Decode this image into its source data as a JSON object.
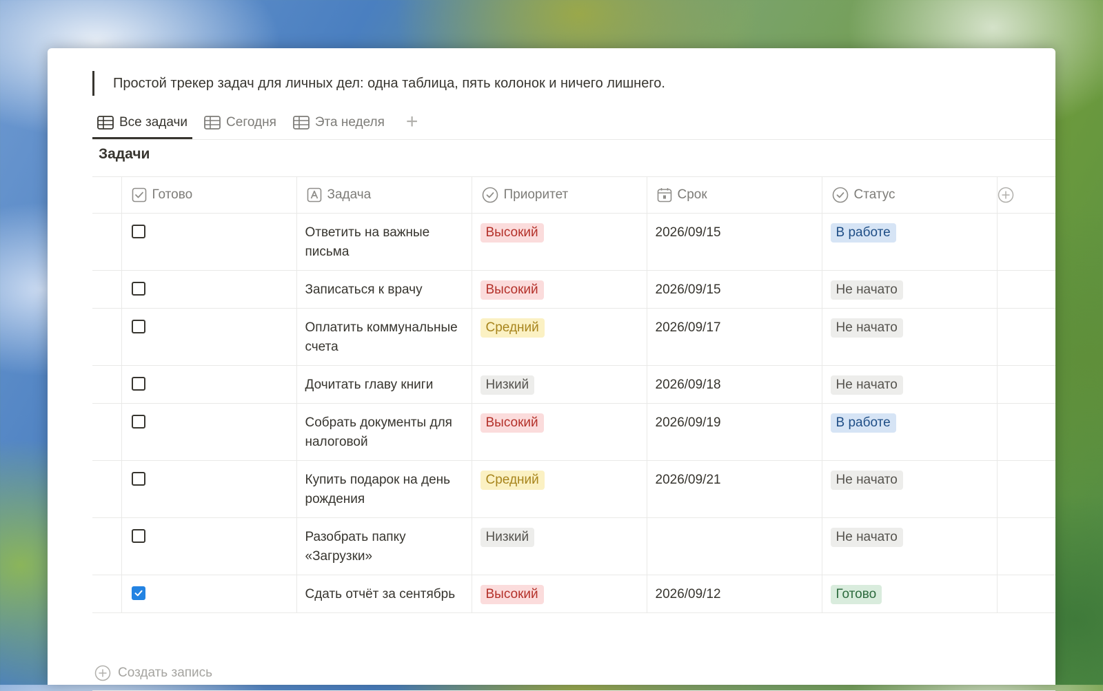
{
  "description": "Простой трекер задач для личных дел: одна таблица, пять колонок и ничего лишнего.",
  "views": [
    {
      "label": "Все задачи",
      "active": true
    },
    {
      "label": "Сегодня",
      "active": false
    },
    {
      "label": "Эта неделя",
      "active": false
    }
  ],
  "database": {
    "title": "Задачи",
    "columns": {
      "done": "Готово",
      "task": "Задача",
      "priority": "Приоритет",
      "due": "Срок",
      "status": "Статус"
    },
    "rows": [
      {
        "done": false,
        "task": "Ответить на важные письма",
        "priority": "Высокий",
        "due": "2026/09/15",
        "status": "В работе"
      },
      {
        "done": false,
        "task": "Записаться к врачу",
        "priority": "Высокий",
        "due": "2026/09/15",
        "status": "Не начато"
      },
      {
        "done": false,
        "task": "Оплатить коммунальные счета",
        "priority": "Средний",
        "due": "2026/09/17",
        "status": "Не начато"
      },
      {
        "done": false,
        "task": "Дочитать главу книги",
        "priority": "Низкий",
        "due": "2026/09/18",
        "status": "Не начато"
      },
      {
        "done": false,
        "task": "Собрать документы для налоговой",
        "priority": "Высокий",
        "due": "2026/09/19",
        "status": "В работе"
      },
      {
        "done": false,
        "task": "Купить подарок на день рождения",
        "priority": "Средний",
        "due": "2026/09/21",
        "status": "Не начато"
      },
      {
        "done": false,
        "task": "Разобрать папку «Загрузки»",
        "priority": "Низкий",
        "due": "",
        "status": "Не начато"
      },
      {
        "done": true,
        "task": "Сдать отчёт за сентябрь",
        "priority": "Высокий",
        "due": "2026/09/12",
        "status": "Готово"
      }
    ],
    "new_row_label": "Создать запись"
  },
  "tag_colors": {
    "Высокий": {
      "bg": "#fbdcdc",
      "fg": "#b4312a"
    },
    "Средний": {
      "bg": "#fbf1c3",
      "fg": "#a8851d"
    },
    "Низкий": {
      "bg": "#ededeb",
      "fg": "#55534e"
    },
    "В работе": {
      "bg": "#d6e4f5",
      "fg": "#1f4e86"
    },
    "Не начато": {
      "bg": "#ededeb",
      "fg": "#55534e"
    },
    "Готово": {
      "bg": "#d9ecdd",
      "fg": "#2c6a3d"
    }
  },
  "icons": {
    "view": "table-grid-icon",
    "add_view": "plus-icon",
    "done_col": "checkbox-icon",
    "task_col": "text-title-icon",
    "priority_col": "status-circle-icon",
    "due_col": "calendar-icon",
    "status_col": "status-circle-icon",
    "add_column": "plus-circle-icon",
    "new_row": "plus-circle-icon"
  },
  "accent_color": "#2383e2"
}
